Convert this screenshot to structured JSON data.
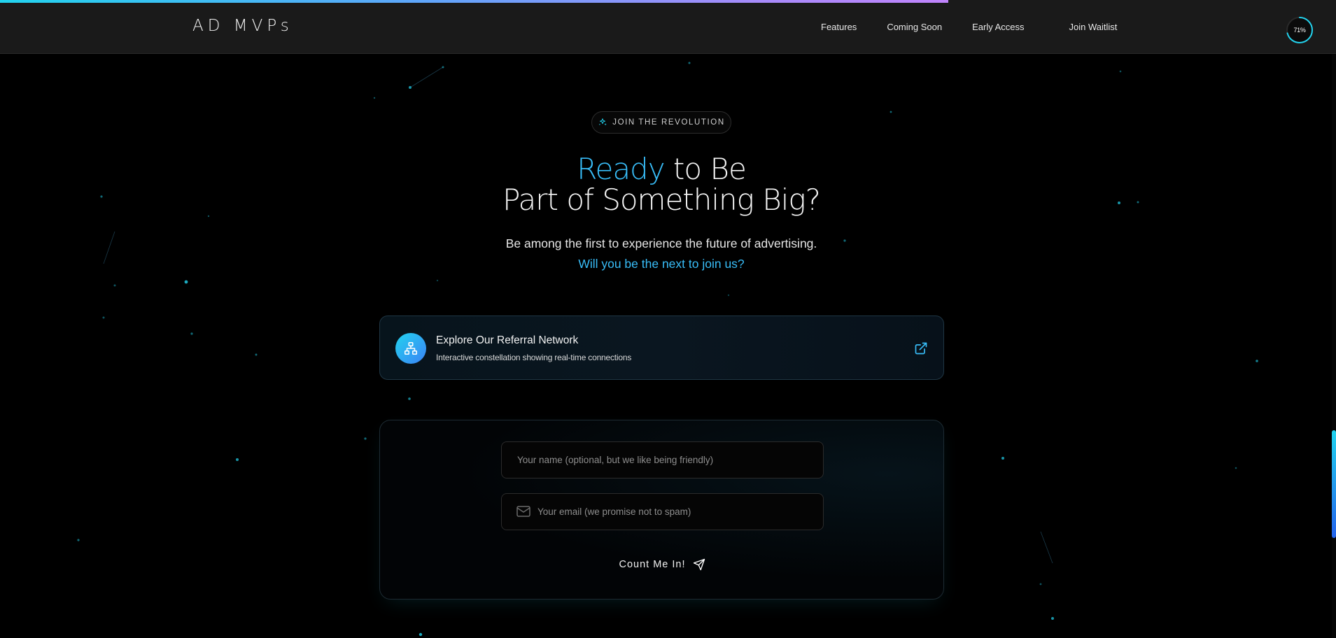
{
  "page": {
    "scroll_progress": 0.71
  },
  "nav": {
    "brand": "AD MVPs",
    "links": [
      "Features",
      "Coming Soon",
      "Early Access",
      "Join Waitlist"
    ],
    "scroll_indicator": "71%"
  },
  "colors": {
    "accent": "#38bdf8",
    "accent_cyan": "#22d3ee",
    "accent_blue": "#3b82f6",
    "background": "#000000",
    "navbar": "#1a1a1a"
  },
  "hero": {
    "badge_icon": "sparkles-icon",
    "badge": "JOIN THE REVOLUTION",
    "headline_accent": "Ready",
    "headline_rest": " to Be",
    "headline_line2": "Part of Something Big?",
    "subtitle": "Be among the first to experience the future of advertising.",
    "subtitle_accent": "Will you be the next to join us?"
  },
  "referral": {
    "icon": "network-icon",
    "title": "Explore Our Referral Network",
    "description": "Interactive constellation showing real-time connections",
    "action_icon": "external-link-icon"
  },
  "form": {
    "name_placeholder": "Your name (optional, but we like being friendly)",
    "email_placeholder": "Your email (we promise not to spam)",
    "email_icon": "mail-icon",
    "submit_label": "Count Me In!",
    "submit_icon": "send-icon"
  }
}
